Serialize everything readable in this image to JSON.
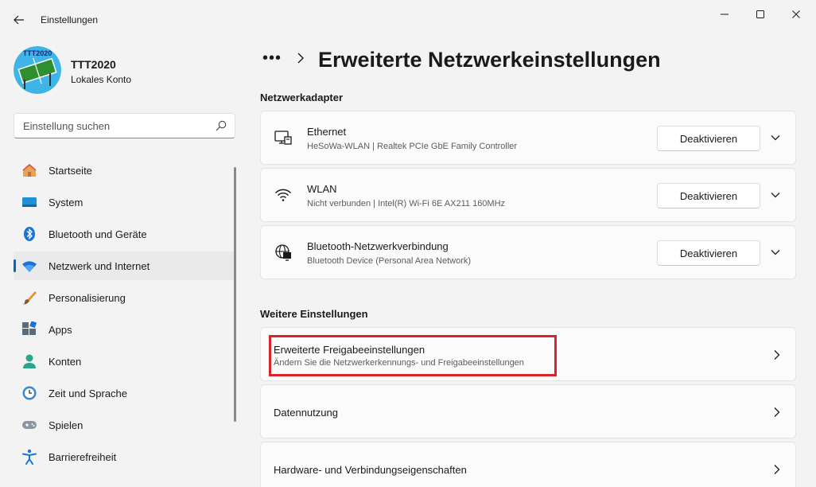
{
  "window": {
    "title": "Einstellungen",
    "controls": {
      "minimize": "minimize-icon",
      "maximize": "maximize-icon",
      "close": "close-icon"
    }
  },
  "profile": {
    "name": "TTT2020",
    "account_type": "Lokales Konto",
    "avatar_text": "TTT2020"
  },
  "search": {
    "placeholder": "Einstellung suchen"
  },
  "sidebar": {
    "items": [
      {
        "label": "Startseite",
        "icon": "home-icon",
        "selected": false
      },
      {
        "label": "System",
        "icon": "system-icon",
        "selected": false
      },
      {
        "label": "Bluetooth und Geräte",
        "icon": "bluetooth-icon",
        "selected": false
      },
      {
        "label": "Netzwerk und Internet",
        "icon": "wifi-icon",
        "selected": true
      },
      {
        "label": "Personalisierung",
        "icon": "brush-icon",
        "selected": false
      },
      {
        "label": "Apps",
        "icon": "apps-icon",
        "selected": false
      },
      {
        "label": "Konten",
        "icon": "person-icon",
        "selected": false
      },
      {
        "label": "Zeit und Sprache",
        "icon": "clock-globe-icon",
        "selected": false
      },
      {
        "label": "Spielen",
        "icon": "gamepad-icon",
        "selected": false
      },
      {
        "label": "Barrierefreiheit",
        "icon": "accessibility-icon",
        "selected": false
      }
    ]
  },
  "breadcrumb": {
    "more": "•••",
    "title": "Erweiterte Netzwerkeinstellungen"
  },
  "sections": {
    "adapters_title": "Netzwerkadapter",
    "more_title": "Weitere Einstellungen"
  },
  "adapters": [
    {
      "name": "Ethernet",
      "description": "HeSoWa-WLAN | Realtek PCIe GbE Family Controller",
      "button": "Deaktivieren",
      "icon": "ethernet-icon"
    },
    {
      "name": "WLAN",
      "description": "Nicht verbunden | Intel(R) Wi-Fi 6E AX211 160MHz",
      "button": "Deaktivieren",
      "icon": "wifi-icon"
    },
    {
      "name": "Bluetooth-Netzwerkverbindung",
      "description": "Bluetooth Device (Personal Area Network)",
      "button": "Deaktivieren",
      "icon": "globe-network-icon"
    }
  ],
  "more_settings": [
    {
      "title": "Erweiterte Freigabeeinstellungen",
      "subtitle": "Ändern Sie die Netzwerkerkennungs- und Freigabeeinstellungen",
      "highlighted": true
    },
    {
      "title": "Datennutzung",
      "subtitle": ""
    },
    {
      "title": "Hardware- und Verbindungseigenschaften",
      "subtitle": ""
    }
  ],
  "colors": {
    "accent": "#0067c0",
    "highlight": "#d9222a",
    "background": "#f3f3f3",
    "card": "#fbfbfb"
  }
}
